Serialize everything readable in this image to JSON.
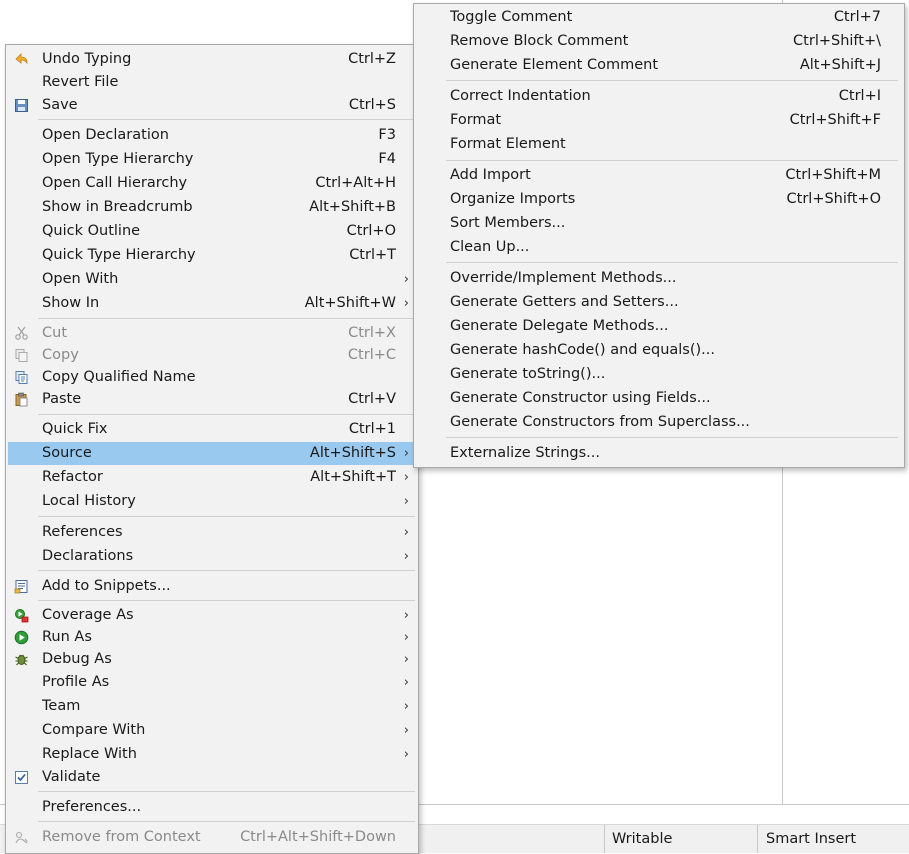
{
  "status_bar": {
    "writable": "Writable",
    "insert_mode": "Smart Insert"
  },
  "context_menu": {
    "items": [
      {
        "label": "Undo Typing",
        "shortcut": "Ctrl+Z",
        "icon": "undo-icon"
      },
      {
        "label": "Revert File",
        "shortcut": ""
      },
      {
        "label": "Save",
        "shortcut": "Ctrl+S",
        "icon": "save-icon"
      },
      {
        "label": "Open Declaration",
        "shortcut": "F3"
      },
      {
        "label": "Open Type Hierarchy",
        "shortcut": "F4"
      },
      {
        "label": "Open Call Hierarchy",
        "shortcut": "Ctrl+Alt+H"
      },
      {
        "label": "Show in Breadcrumb",
        "shortcut": "Alt+Shift+B"
      },
      {
        "label": "Quick Outline",
        "shortcut": "Ctrl+O"
      },
      {
        "label": "Quick Type Hierarchy",
        "shortcut": "Ctrl+T"
      },
      {
        "label": "Open With",
        "shortcut": "",
        "submenu": true
      },
      {
        "label": "Show In",
        "shortcut": "Alt+Shift+W",
        "submenu": true
      },
      {
        "label": "Cut",
        "shortcut": "Ctrl+X",
        "icon": "cut-icon",
        "disabled": true
      },
      {
        "label": "Copy",
        "shortcut": "Ctrl+C",
        "icon": "copy-icon",
        "disabled": true
      },
      {
        "label": "Copy Qualified Name",
        "shortcut": "",
        "icon": "copy-qualified-name-icon"
      },
      {
        "label": "Paste",
        "shortcut": "Ctrl+V",
        "icon": "paste-icon"
      },
      {
        "label": "Quick Fix",
        "shortcut": "Ctrl+1"
      },
      {
        "label": "Source",
        "shortcut": "Alt+Shift+S",
        "submenu": true,
        "highlighted": true
      },
      {
        "label": "Refactor",
        "shortcut": "Alt+Shift+T",
        "submenu": true
      },
      {
        "label": "Local History",
        "shortcut": "",
        "submenu": true
      },
      {
        "label": "References",
        "shortcut": "",
        "submenu": true
      },
      {
        "label": "Declarations",
        "shortcut": "",
        "submenu": true
      },
      {
        "label": "Add to Snippets...",
        "shortcut": "",
        "icon": "snippets-icon"
      },
      {
        "label": "Coverage As",
        "shortcut": "",
        "submenu": true,
        "icon": "coverage-icon"
      },
      {
        "label": "Run As",
        "shortcut": "",
        "submenu": true,
        "icon": "run-icon"
      },
      {
        "label": "Debug As",
        "shortcut": "",
        "submenu": true,
        "icon": "debug-icon"
      },
      {
        "label": "Profile As",
        "shortcut": "",
        "submenu": true
      },
      {
        "label": "Team",
        "shortcut": "",
        "submenu": true
      },
      {
        "label": "Compare With",
        "shortcut": "",
        "submenu": true
      },
      {
        "label": "Replace With",
        "shortcut": "",
        "submenu": true
      },
      {
        "label": "Validate",
        "shortcut": "",
        "icon": "validate-checkbox-icon"
      },
      {
        "label": "Preferences...",
        "shortcut": ""
      },
      {
        "label": "Remove from Context",
        "shortcut": "Ctrl+Alt+Shift+Down",
        "icon": "remove-from-context-icon",
        "disabled": true
      }
    ]
  },
  "source_submenu": {
    "items": [
      {
        "label": "Toggle Comment",
        "shortcut": "Ctrl+7"
      },
      {
        "label": "Remove Block Comment",
        "shortcut": "Ctrl+Shift+\\"
      },
      {
        "label": "Generate Element Comment",
        "shortcut": "Alt+Shift+J"
      },
      {
        "label": "Correct Indentation",
        "shortcut": "Ctrl+I"
      },
      {
        "label": "Format",
        "shortcut": "Ctrl+Shift+F"
      },
      {
        "label": "Format Element",
        "shortcut": ""
      },
      {
        "label": "Add Import",
        "shortcut": "Ctrl+Shift+M"
      },
      {
        "label": "Organize Imports",
        "shortcut": "Ctrl+Shift+O"
      },
      {
        "label": "Sort Members...",
        "shortcut": ""
      },
      {
        "label": "Clean Up...",
        "shortcut": ""
      },
      {
        "label": "Override/Implement Methods...",
        "shortcut": ""
      },
      {
        "label": "Generate Getters and Setters...",
        "shortcut": ""
      },
      {
        "label": "Generate Delegate Methods...",
        "shortcut": ""
      },
      {
        "label": "Generate hashCode() and equals()...",
        "shortcut": ""
      },
      {
        "label": "Generate toString()...",
        "shortcut": ""
      },
      {
        "label": "Generate Constructor using Fields...",
        "shortcut": ""
      },
      {
        "label": "Generate Constructors from Superclass...",
        "shortcut": ""
      },
      {
        "label": "Externalize Strings...",
        "shortcut": ""
      }
    ]
  },
  "colors": {
    "highlight": "#99c9ef",
    "menu_bg": "#f2f2f2",
    "disabled_text": "#8a8a8a"
  }
}
